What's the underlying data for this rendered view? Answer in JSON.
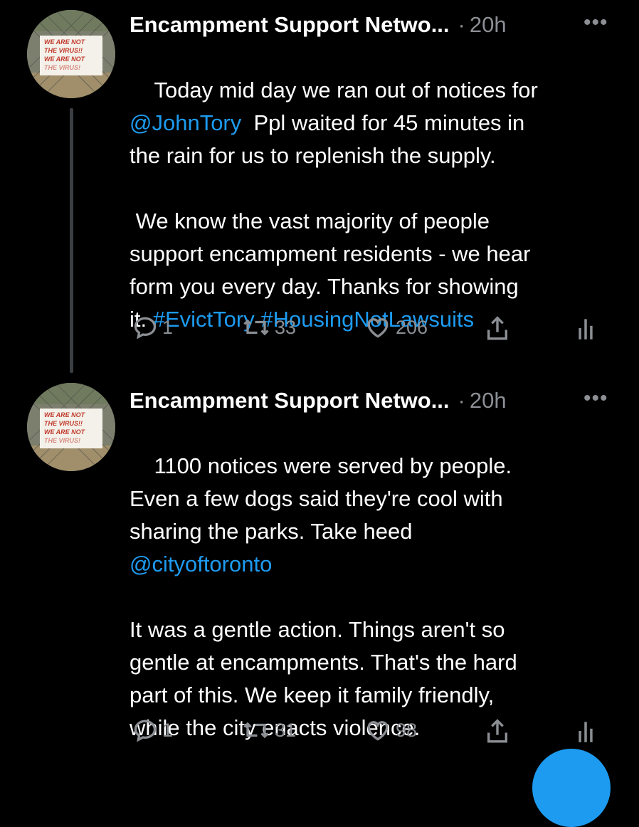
{
  "tweets": [
    {
      "name": "Encampment Support Netwo...",
      "time": "20h",
      "more": "•••",
      "body": [
        {
          "text": "Today mid day we ran out of notices for\n"
        },
        {
          "text": "@JohnTory",
          "link": true
        },
        {
          "text": "  Ppl waited for 45 minutes in\nthe rain for us to replenish the supply.\n\n We know the vast majority of people\nsupport encampment residents - we hear\nform you every day. Thanks for showing\nit. "
        },
        {
          "text": "#EvictTory",
          "link": true
        },
        {
          "text": " "
        },
        {
          "text": "#HousingNotLawsuits",
          "link": true
        }
      ],
      "replies": "1",
      "retweets": "33",
      "likes": "206",
      "avatar_sign": [
        "WE ARE NOT",
        "THE VIRUS!!",
        "WE ARE NOT",
        "THE VIRUS!"
      ]
    },
    {
      "name": "Encampment Support Netwo...",
      "time": "20h",
      "more": "•••",
      "body": [
        {
          "text": "1100 notices were served by people.\nEven a few dogs said they're cool with\nsharing the parks. Take heed\n"
        },
        {
          "text": "@cityoftoronto",
          "link": true
        },
        {
          "text": "\n\nIt was a gentle action. Things aren't so\ngentle at encampments. That's the hard\npart of this. We keep it family friendly,\nwhile the city enacts violence."
        }
      ],
      "replies": "1",
      "retweets": "31",
      "likes": "98",
      "avatar_sign": [
        "WE ARE NOT",
        "THE VIRUS!!",
        "WE ARE NOT",
        "THE VIRUS!"
      ]
    }
  ],
  "colors": {
    "accent": "#1d9bf0",
    "muted": "#8b8f94",
    "background": "#000000"
  },
  "icons": [
    "reply-icon",
    "retweet-icon",
    "like-icon",
    "share-icon",
    "analytics-icon",
    "more-icon"
  ]
}
